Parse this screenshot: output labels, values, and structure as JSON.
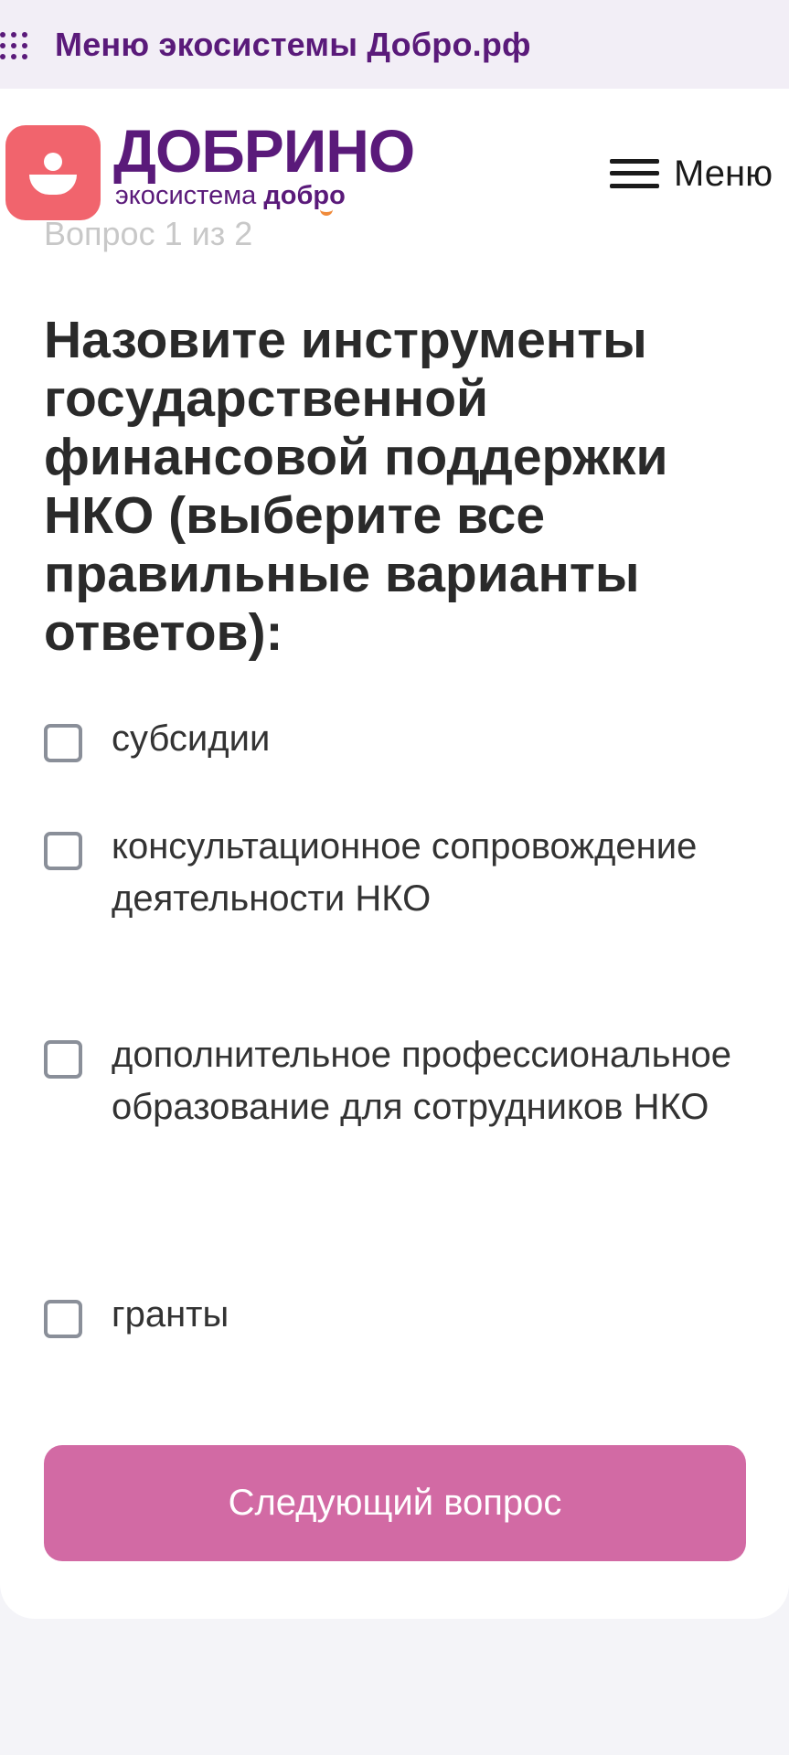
{
  "eco_bar": {
    "icon": "grid-dots-icon",
    "label": "Меню экосистемы Добро.рф"
  },
  "header": {
    "logo_icon": "person-badge-icon",
    "logo_title": "ДОБРИНО",
    "logo_sub_prefix": "экосистема ",
    "logo_sub_brand": "добро",
    "menu_icon": "hamburger-icon",
    "menu_label": "Меню"
  },
  "quiz": {
    "progress": "Вопрос 1 из 2",
    "question": "Назовите инструменты государственной финансовой поддержки НКО (выберите все правильные варианты ответов):",
    "options": [
      {
        "label": "субсидии",
        "checked": false
      },
      {
        "label": "консультационное сопровождение деятельности НКО",
        "checked": false
      },
      {
        "label": "дополнительное профессиональное образование для сотрудников НКО",
        "checked": false
      },
      {
        "label": "гранты",
        "checked": false
      }
    ],
    "next_label": "Следующий вопрос"
  },
  "colors": {
    "brand_purple": "#5a1a7a",
    "logo_coral": "#f1646d",
    "button_pink": "#d26aa4",
    "eco_bar_bg": "#f2eef6"
  }
}
